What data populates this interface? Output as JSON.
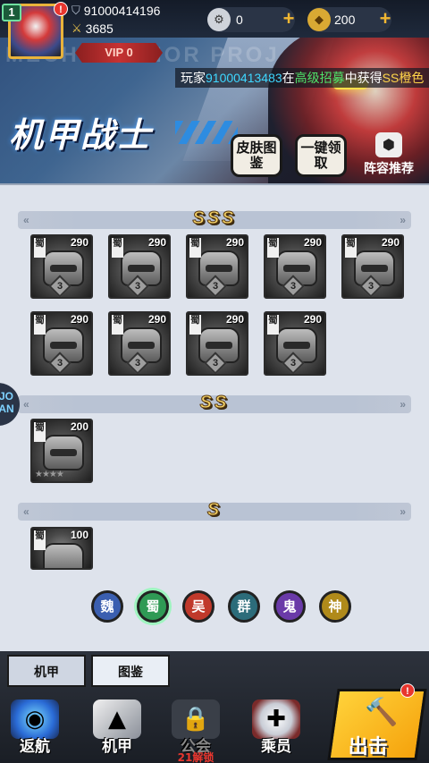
{
  "player": {
    "level": "1",
    "id": "91000414196",
    "power": "3685",
    "vip": "VIP 0",
    "alert": "!"
  },
  "resources": {
    "gear": "0",
    "coin": "200"
  },
  "banner": {
    "watermark": "MECHWARRIOR PROJ",
    "marquee": {
      "prefix": "玩家",
      "player": "91000413483",
      "mid1": "在",
      "pool": "高级招募",
      "mid2": "中获得",
      "item": "SS橙色"
    },
    "title": "机甲战士",
    "skin_button": "皮肤图鉴",
    "claim_button": "一键领取",
    "lineup_button": "阵容推荐"
  },
  "sections": {
    "sss": "SSS",
    "ss": "SS",
    "s": "S"
  },
  "cards": {
    "sss": [
      {
        "faction": "蜀",
        "power": "290",
        "star": "3"
      },
      {
        "faction": "蜀",
        "power": "290",
        "star": "3"
      },
      {
        "faction": "蜀",
        "power": "290",
        "star": "3"
      },
      {
        "faction": "蜀",
        "power": "290",
        "star": "3"
      },
      {
        "faction": "蜀",
        "power": "290",
        "star": "3"
      },
      {
        "faction": "蜀",
        "power": "290",
        "star": "3"
      },
      {
        "faction": "蜀",
        "power": "290",
        "star": "3"
      },
      {
        "faction": "蜀",
        "power": "290",
        "star": "3"
      },
      {
        "faction": "蜀",
        "power": "290",
        "star": "3"
      }
    ],
    "ss": [
      {
        "faction": "蜀",
        "power": "200"
      }
    ],
    "s": [
      {
        "faction": "蜀",
        "power": "100"
      }
    ]
  },
  "side_button": "JO AN",
  "factions": [
    "魏",
    "蜀",
    "吴",
    "群",
    "鬼",
    "神"
  ],
  "faction_colors": [
    "#3b5fb0",
    "#2f9a55",
    "#c0392b",
    "#2c6c7a",
    "#6a3aa8",
    "#b08a1a"
  ],
  "tabs": {
    "mecha": "机甲",
    "atlas": "图鉴"
  },
  "nav": {
    "back": "返航",
    "mecha": "机甲",
    "locked": "21解锁",
    "locked_label": "公会",
    "crew": "乘员",
    "fight": "出击"
  },
  "colors": {
    "accent_gold": "#f6d66a",
    "alert_red": "#e8362e"
  }
}
